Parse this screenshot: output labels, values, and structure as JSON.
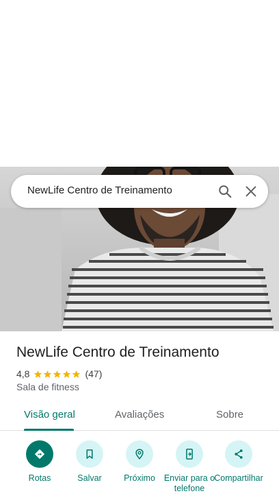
{
  "search": {
    "query": "NewLife Centro de Treinamento",
    "search_icon": "search-icon",
    "close_icon": "close-icon"
  },
  "place": {
    "title": "NewLife Centro de Treinamento",
    "rating": "4,8",
    "rating_stars": 5,
    "review_count": "(47)",
    "category": "Sala de fitness"
  },
  "tabs": [
    {
      "label": "Visão geral",
      "active": true
    },
    {
      "label": "Avaliações",
      "active": false
    },
    {
      "label": "Sobre",
      "active": false
    }
  ],
  "actions": [
    {
      "label": "Rotas",
      "icon": "directions-icon"
    },
    {
      "label": "Salvar",
      "icon": "bookmark-icon"
    },
    {
      "label": "Próximo",
      "icon": "nearby-icon"
    },
    {
      "label": "Enviar para o telefone",
      "icon": "send-to-phone-icon"
    },
    {
      "label": "Compartilhar",
      "icon": "share-icon"
    }
  ],
  "colors": {
    "accent": "#00796b",
    "action_bg": "#d5f4f5",
    "star": "#f4b400"
  }
}
